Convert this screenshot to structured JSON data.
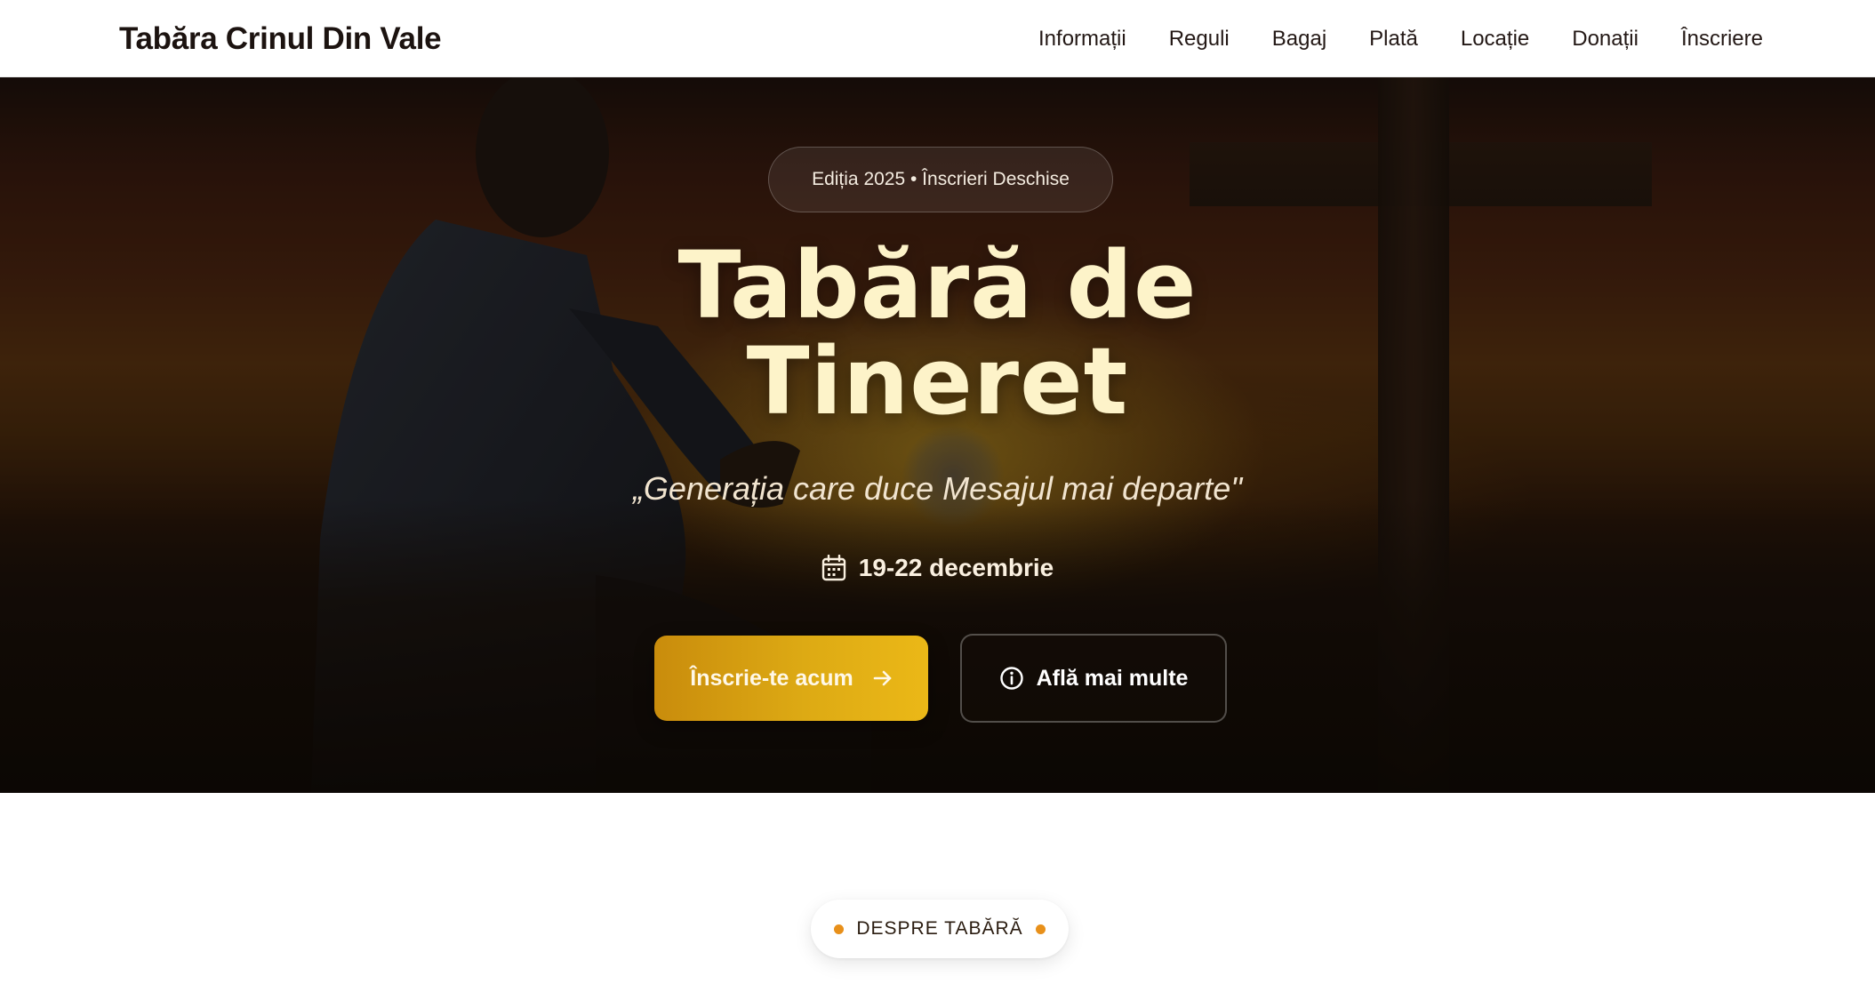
{
  "brand": {
    "title": "Tabăra Crinul Din Vale"
  },
  "nav": {
    "items": [
      {
        "label": "Informații"
      },
      {
        "label": "Reguli"
      },
      {
        "label": "Bagaj"
      },
      {
        "label": "Plată"
      },
      {
        "label": "Locație"
      },
      {
        "label": "Donații"
      },
      {
        "label": "Înscriere"
      }
    ]
  },
  "hero": {
    "badge": "Ediția 2025 • Înscrieri Deschise",
    "title_line1": "Tabără de",
    "title_line2": "Tineret",
    "quote": "„Generația care duce Mesajul mai departe\"",
    "date": "19-22 decembrie",
    "primary_button": "Înscrie-te acum",
    "secondary_button": "Află mai multe",
    "icons": {
      "date": "calendar-icon",
      "primary": "arrow-right-icon",
      "secondary": "info-icon"
    }
  },
  "about": {
    "pill_label": "DESPRE TABĂRĂ"
  },
  "colors": {
    "accent": "#ddaa14",
    "title": "#fdf3c9",
    "dot": "#e8901a"
  }
}
